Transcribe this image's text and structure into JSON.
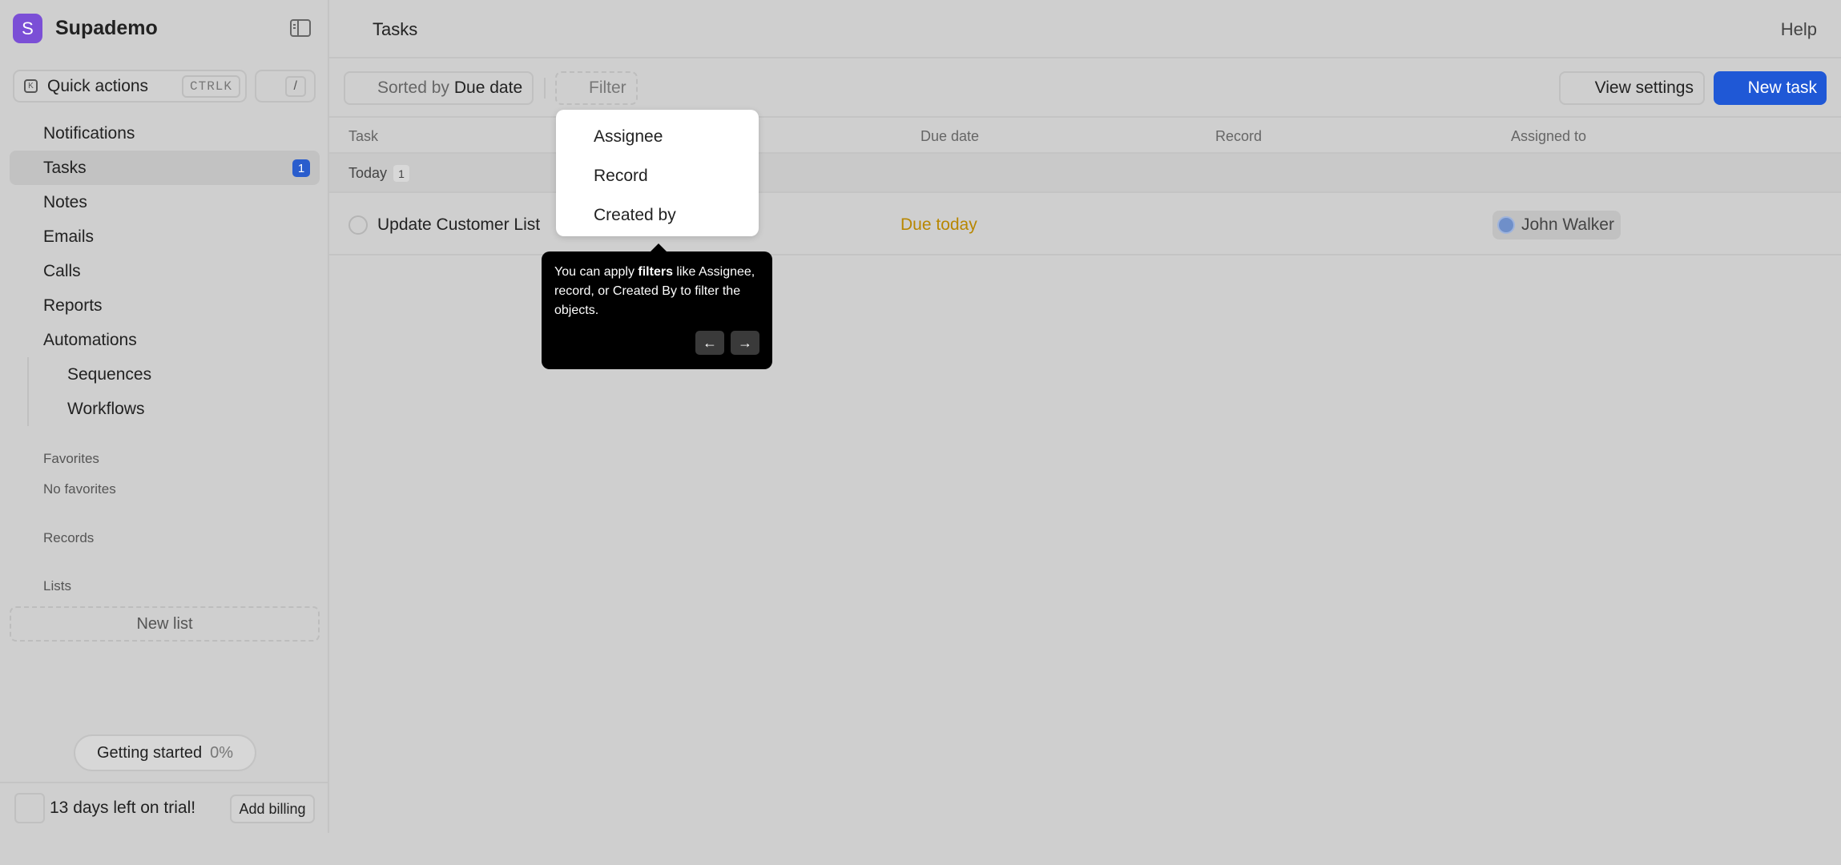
{
  "brand": {
    "logo_letter": "S",
    "name": "Supademo",
    "logo_color": "#7b4fd6"
  },
  "quick_actions": {
    "label": "Quick actions",
    "shortcut": "CTRLK",
    "slash": "/"
  },
  "sidebar": {
    "items": [
      {
        "label": "Notifications"
      },
      {
        "label": "Tasks",
        "badge": "1"
      },
      {
        "label": "Notes"
      },
      {
        "label": "Emails"
      },
      {
        "label": "Calls"
      },
      {
        "label": "Reports"
      },
      {
        "label": "Automations"
      }
    ],
    "subitems": [
      {
        "label": "Sequences"
      },
      {
        "label": "Workflows"
      }
    ],
    "favorites_label": "Favorites",
    "no_favorites": "No favorites",
    "records_label": "Records",
    "lists_label": "Lists",
    "new_list": "New list"
  },
  "getting_started": {
    "label": "Getting started",
    "percent": "0%"
  },
  "trial": {
    "text": "13 days left on trial!",
    "billing_button": "Add billing"
  },
  "header": {
    "title": "Tasks",
    "help": "Help"
  },
  "toolbar": {
    "sorted_by_prefix": "Sorted by",
    "sorted_by_value": "Due date",
    "filter": "Filter",
    "view_settings": "View settings",
    "new_task": "New task",
    "accent": "#1f58d6"
  },
  "table": {
    "columns": [
      "Task",
      "Due date",
      "Record",
      "Assigned to"
    ],
    "group": {
      "label": "Today",
      "count": "1"
    },
    "rows": [
      {
        "task": "Update Customer List",
        "due": "Due today",
        "record": "",
        "assigned_to": "John Walker"
      }
    ]
  },
  "filter_menu": {
    "items": [
      "Assignee",
      "Record",
      "Created by"
    ]
  },
  "tooltip": {
    "part1": "You can apply ",
    "bold": "filters",
    "part2": " like Assignee, record, or Created By to filter the objects.",
    "prev": "←",
    "next": "→"
  }
}
